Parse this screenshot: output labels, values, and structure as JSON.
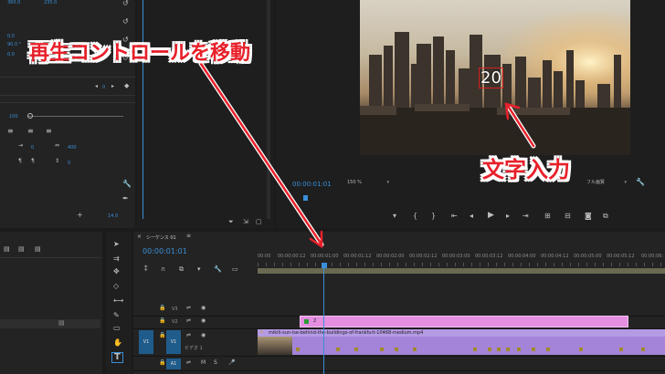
{
  "effect_controls": {
    "val1": "360.0",
    "val2": "235.0",
    "val3": "0.0",
    "val4": "90.0 °",
    "val5": "0.0",
    "val6": "0.0",
    "slider_value": "100",
    "indent_value": "0",
    "spacing_value": "400",
    "baseline_value": "0",
    "tsume_value": "0",
    "keyframe_value": "0",
    "footer_value": "14.0"
  },
  "program_monitor": {
    "timecode": "00:00:01:01",
    "zoom": "150 %",
    "resolution": "フル画質",
    "overlay_text": "20"
  },
  "sequence": {
    "name": "シーケンス 01",
    "timecode": "00:00:01:01",
    "ruler": [
      "00:00",
      "00:00:00:12",
      "00:00:01:00",
      "00:00:01:12",
      "00:00:02:00",
      "00:00:02:12",
      "00:00:03:00",
      "00:00:03:12",
      "00:00:04:00",
      "00:00:04:12",
      "00:00:05:00",
      "00:00:05:12",
      "00:00:06:"
    ],
    "tracks": [
      {
        "id": "V3",
        "label": "V3"
      },
      {
        "id": "V2",
        "label": "V2"
      },
      {
        "id": "V1",
        "label": "V1",
        "source": "V1",
        "name": "ビデオ 1"
      },
      {
        "id": "A1",
        "label": "A1"
      }
    ],
    "graphic_clip_label": "2",
    "video_clip_name": "mikili-sun-ise-behind-the-buildings-of-frankfurt-10468-medium.mp4"
  },
  "annotations": {
    "playhead": "再生コントロールを移動",
    "text_input": "文字入力"
  },
  "colors": {
    "accent_blue": "#3a8fd8",
    "graphic_clip": "#e48fe0",
    "video_clip": "#a384d8",
    "annotation_red": "#e8202a"
  }
}
